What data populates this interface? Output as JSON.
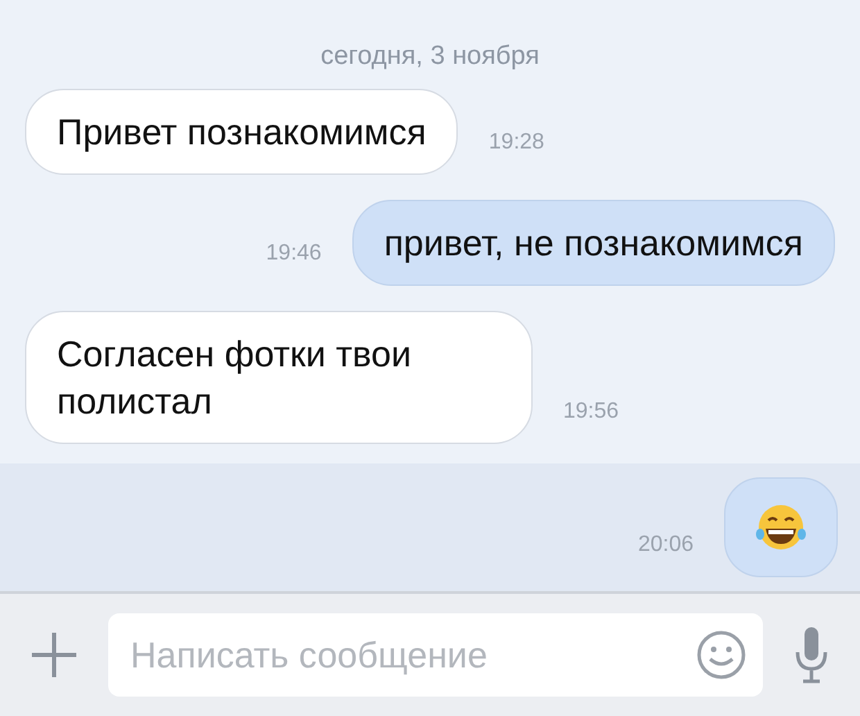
{
  "date_divider": "сегодня, 3 ноября",
  "messages": [
    {
      "kind": "incoming",
      "text": "Привет познакомимся",
      "time": "19:28",
      "unread": false
    },
    {
      "kind": "outgoing",
      "text": "привет, не познакомимся",
      "time": "19:46",
      "unread": false
    },
    {
      "kind": "incoming",
      "text": "Согласен фотки твои полистал",
      "time": "19:56",
      "unread": false
    },
    {
      "kind": "emoji",
      "time": "20:06",
      "unread": true
    }
  ],
  "composer": {
    "placeholder": "Написать сообщение"
  }
}
